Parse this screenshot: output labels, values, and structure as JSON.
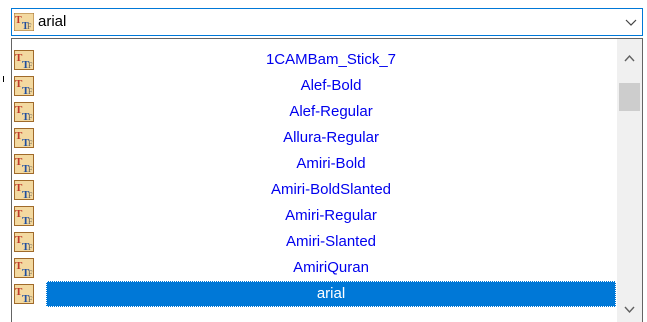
{
  "combo": {
    "value": "arial",
    "icon": "truetype-font-icon"
  },
  "dropdown": {
    "items": [
      {
        "label": "1CAMBam_Stick_7",
        "icon": "truetype-font-icon"
      },
      {
        "label": "Alef-Bold",
        "icon": "truetype-font-icon"
      },
      {
        "label": "Alef-Regular",
        "icon": "truetype-font-icon"
      },
      {
        "label": "Allura-Regular",
        "icon": "truetype-font-icon"
      },
      {
        "label": "Amiri-Bold",
        "icon": "truetype-font-icon"
      },
      {
        "label": "Amiri-BoldSlanted",
        "icon": "truetype-font-icon"
      },
      {
        "label": "Amiri-Regular",
        "icon": "truetype-font-icon"
      },
      {
        "label": "Amiri-Slanted",
        "icon": "truetype-font-icon"
      },
      {
        "label": "AmiriQuran",
        "icon": "truetype-font-icon"
      },
      {
        "label": "arial",
        "icon": "truetype-font-icon",
        "selected": true
      }
    ]
  },
  "colors": {
    "accent": "#0078d7",
    "item_text": "#0000ee",
    "selected_text": "#ffffff"
  }
}
